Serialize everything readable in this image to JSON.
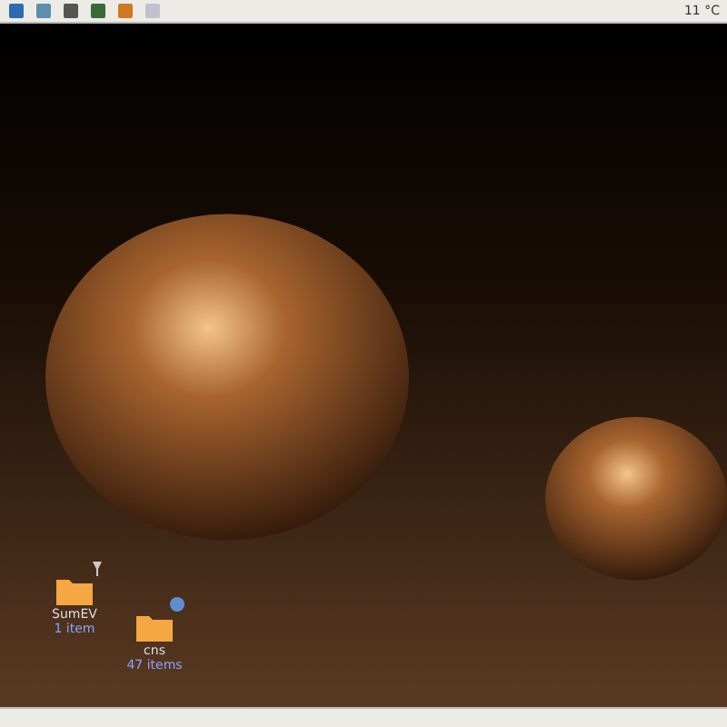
{
  "top_panel": {
    "weather": "11 °C"
  },
  "desktop_icons": [
    {
      "name": "SumEV",
      "detail": "1 item"
    },
    {
      "name": "cns",
      "detail": "47 items"
    }
  ]
}
